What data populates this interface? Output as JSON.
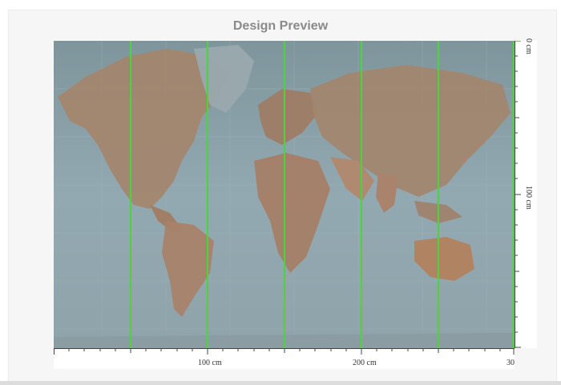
{
  "title": "Design Preview",
  "bottom_ruler": {
    "labels": [
      "100 cm",
      "200 cm",
      "30"
    ]
  },
  "right_ruler": {
    "labels": [
      "0 cm",
      "100 cm"
    ]
  },
  "colors": {
    "seam_lines": "#4cd43c",
    "title_text": "#8a8a8a",
    "ocean": "#8ea3ab",
    "land": "#a68a72"
  }
}
